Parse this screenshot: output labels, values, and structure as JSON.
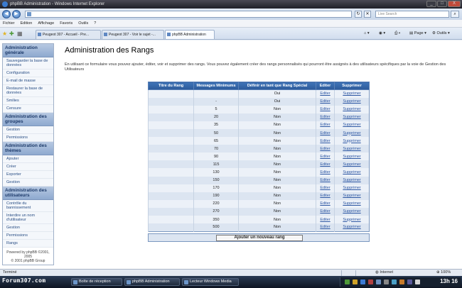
{
  "window": {
    "title": "phpBB Administration - Windows Internet Explorer",
    "min": "_",
    "max": "□",
    "close": "X"
  },
  "address": {
    "value": "",
    "refresh": "↻",
    "stop": "✕"
  },
  "search": {
    "placeholder": "Live Search",
    "go": "⌕"
  },
  "menu": [
    "Fichier",
    "Edition",
    "Affichage",
    "Favoris",
    "Outils",
    "?"
  ],
  "tabs": [
    {
      "label": "Peugeot 307 - Accueil - Pre..."
    },
    {
      "label": "Peugeot 307 - Voir le sujet -..."
    },
    {
      "label": "phpBB Administration"
    }
  ],
  "toolbar": {
    "page": "Page",
    "outils": "Outils"
  },
  "sidebar": {
    "sections": [
      {
        "title": "Administration générale",
        "items": [
          "Sauvegarder la base de données",
          "Configuration",
          "E-mail de masse",
          "Restaurer la base de données",
          "Smilies",
          "Censure"
        ]
      },
      {
        "title": "Administration des groupes",
        "items": [
          "Gestion",
          "Permissions"
        ]
      },
      {
        "title": "Administration des thèmes",
        "items": [
          "Ajouter",
          "Créer",
          "Exporter",
          "Gestion"
        ]
      },
      {
        "title": "Administration des utilisateurs",
        "items": [
          "Contrôle du bannissement",
          "Interdire un nom d'utilisateur",
          "Gestion",
          "Permissions",
          "Rangs"
        ]
      }
    ],
    "footer_line1": "Powered by phpBB ©2001, 2005",
    "footer_line2": "© 2001 phpBB Group"
  },
  "main": {
    "title": "Administration des Rangs",
    "intro": "En utilisant ce formulaire vous pouvez ajouter, éditer, voir et supprimer des rangs. Vous pouvez également créer des rangs personnalisés qui pourront être assignés à des utilisateurs spécifiques par la voie de Gestion des Utilisateurs"
  },
  "table": {
    "headers": [
      "Titre du Rang",
      "Messages Minimums",
      "Définir en tant que Rang Spécial",
      "Editer",
      "Supprimer"
    ],
    "rows": [
      [
        "",
        "",
        "Oui",
        "Editer",
        "Supprimer"
      ],
      [
        "",
        "-",
        "Oui",
        "Editer",
        "Supprimer"
      ],
      [
        "",
        "5",
        "Non",
        "Editer",
        "Supprimer"
      ],
      [
        "",
        "20",
        "Non",
        "Editer",
        "Supprimer"
      ],
      [
        "",
        "35",
        "Non",
        "Editer",
        "Supprimer"
      ],
      [
        "",
        "50",
        "Non",
        "Editer",
        "Supprimer"
      ],
      [
        "",
        "65",
        "Non",
        "Editer",
        "Supprimer"
      ],
      [
        "",
        "70",
        "Non",
        "Editer",
        "Supprimer"
      ],
      [
        "",
        "90",
        "Non",
        "Editer",
        "Supprimer"
      ],
      [
        "",
        "115",
        "Non",
        "Editer",
        "Supprimer"
      ],
      [
        "",
        "130",
        "Non",
        "Editer",
        "Supprimer"
      ],
      [
        "",
        "150",
        "Non",
        "Editer",
        "Supprimer"
      ],
      [
        "",
        "170",
        "Non",
        "Editer",
        "Supprimer"
      ],
      [
        "",
        "190",
        "Non",
        "Editer",
        "Supprimer"
      ],
      [
        "",
        "220",
        "Non",
        "Editer",
        "Supprimer"
      ],
      [
        "",
        "270",
        "Non",
        "Editer",
        "Supprimer"
      ],
      [
        "",
        "350",
        "Non",
        "Editer",
        "Supprimer"
      ],
      [
        "",
        "500",
        "Non",
        "Editer",
        "Supprimer"
      ]
    ],
    "add_button": "Ajouter un nouveau rang"
  },
  "status": {
    "left": "Terminé",
    "zone": "Internet",
    "zoom": "100%"
  },
  "taskbar": {
    "logo": "Forum307.com",
    "tasks": [
      "Boîte de réception",
      "phpBB Administration",
      "Lecteur Windows Media"
    ],
    "clock": "13h 16"
  },
  "colors": {
    "header_blue": "#2c5a99",
    "link": "#2d57a3"
  }
}
